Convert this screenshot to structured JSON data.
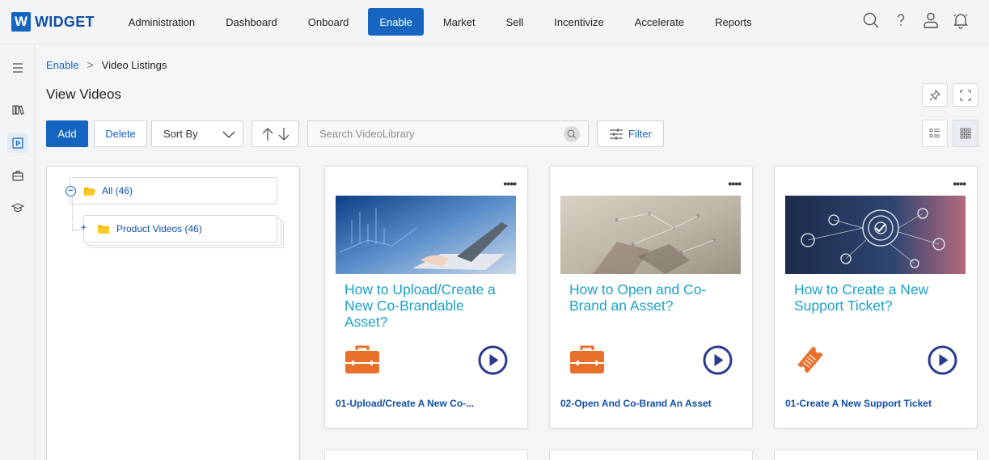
{
  "brand": {
    "logo_letter": "W",
    "name": "WIDGET",
    "color": "#1565c0"
  },
  "nav": {
    "items": [
      {
        "label": "Administration"
      },
      {
        "label": "Dashboard"
      },
      {
        "label": "Onboard"
      },
      {
        "label": "Enable",
        "active": true
      },
      {
        "label": "Market"
      },
      {
        "label": "Sell"
      },
      {
        "label": "Incentivize"
      },
      {
        "label": "Accelerate"
      },
      {
        "label": "Reports"
      }
    ],
    "icons": [
      "search-icon",
      "help-icon",
      "user-icon",
      "notification-bell-icon"
    ]
  },
  "rail": {
    "items": [
      "menu-icon",
      "library-icon",
      "video-icon",
      "briefcase-icon",
      "graduation-cap-icon"
    ],
    "active": "video-icon"
  },
  "breadcrumb": {
    "parent": "Enable",
    "separator": ">",
    "current": "Video Listings"
  },
  "page": {
    "title": "View Videos"
  },
  "toolbar": {
    "add_label": "Add",
    "delete_label": "Delete",
    "sort_label": "Sort By",
    "search_placeholder": "Search VideoLibrary",
    "search_value": "",
    "filter_label": "Filter",
    "view_mode": "grid"
  },
  "tree": {
    "root": {
      "label": "All (46)",
      "expanded": true
    },
    "children": [
      {
        "label": "Product Videos (46)",
        "expanded": false
      }
    ]
  },
  "cards": [
    {
      "title": "How to Upload/Create a New Co-Brandable Asset?",
      "name": "01-Upload/Create A New Co-...",
      "icon": "briefcase-icon"
    },
    {
      "title": "How to Open and Co-Brand an Asset?",
      "name": "02-Open And Co-Brand An Asset",
      "icon": "briefcase-icon"
    },
    {
      "title": "How to Create a New Support Ticket?",
      "name": "01-Create A New Support Ticket",
      "icon": "ticket-icon"
    }
  ],
  "colors": {
    "accent": "#1565c0",
    "title_teal": "#1ba1c9",
    "icon_orange": "#e8702a"
  }
}
